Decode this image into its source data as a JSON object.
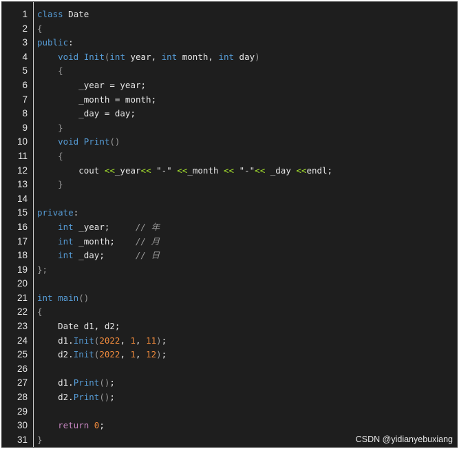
{
  "editor": {
    "lines": [
      {
        "n": "1",
        "tokens": [
          [
            "kw",
            "class"
          ],
          [
            "plain",
            " Date"
          ]
        ]
      },
      {
        "n": "2",
        "tokens": [
          [
            "punc",
            "{"
          ]
        ]
      },
      {
        "n": "3",
        "tokens": [
          [
            "kw",
            "public"
          ],
          [
            "plain",
            ":"
          ]
        ]
      },
      {
        "n": "4",
        "tokens": [
          [
            "plain",
            "    "
          ],
          [
            "ty",
            "void"
          ],
          [
            "plain",
            " "
          ],
          [
            "fn",
            "Init"
          ],
          [
            "punc",
            "("
          ],
          [
            "ty",
            "int"
          ],
          [
            "plain",
            " year, "
          ],
          [
            "ty",
            "int"
          ],
          [
            "plain",
            " month, "
          ],
          [
            "ty",
            "int"
          ],
          [
            "plain",
            " day"
          ],
          [
            "punc",
            ")"
          ]
        ]
      },
      {
        "n": "5",
        "tokens": [
          [
            "plain",
            "    "
          ],
          [
            "punc",
            "{"
          ]
        ]
      },
      {
        "n": "6",
        "tokens": [
          [
            "plain",
            "        _year = year;"
          ]
        ]
      },
      {
        "n": "7",
        "tokens": [
          [
            "plain",
            "        _month = month;"
          ]
        ]
      },
      {
        "n": "8",
        "tokens": [
          [
            "plain",
            "        _day = day;"
          ]
        ]
      },
      {
        "n": "9",
        "tokens": [
          [
            "plain",
            "    "
          ],
          [
            "punc",
            "}"
          ]
        ]
      },
      {
        "n": "10",
        "tokens": [
          [
            "plain",
            "    "
          ],
          [
            "ty",
            "void"
          ],
          [
            "plain",
            " "
          ],
          [
            "fn",
            "Print"
          ],
          [
            "punc",
            "()"
          ]
        ]
      },
      {
        "n": "11",
        "tokens": [
          [
            "plain",
            "    "
          ],
          [
            "punc",
            "{"
          ]
        ]
      },
      {
        "n": "12",
        "tokens": [
          [
            "plain",
            "        cout "
          ],
          [
            "op",
            "<<"
          ],
          [
            "plain",
            "_year"
          ],
          [
            "op",
            "<<"
          ],
          [
            "plain",
            " \"-\" "
          ],
          [
            "op",
            "<<"
          ],
          [
            "plain",
            "_month "
          ],
          [
            "op",
            "<<"
          ],
          [
            "plain",
            " \"-\""
          ],
          [
            "op",
            "<<"
          ],
          [
            "plain",
            " _day "
          ],
          [
            "op",
            "<<"
          ],
          [
            "plain",
            "endl;"
          ]
        ]
      },
      {
        "n": "13",
        "tokens": [
          [
            "plain",
            "    "
          ],
          [
            "punc",
            "}"
          ]
        ]
      },
      {
        "n": "14",
        "tokens": []
      },
      {
        "n": "15",
        "tokens": [
          [
            "kw",
            "private"
          ],
          [
            "plain",
            ":"
          ]
        ]
      },
      {
        "n": "16",
        "tokens": [
          [
            "plain",
            "    "
          ],
          [
            "ty",
            "int"
          ],
          [
            "plain",
            " _year;     "
          ],
          [
            "cm",
            "// 年"
          ]
        ]
      },
      {
        "n": "17",
        "tokens": [
          [
            "plain",
            "    "
          ],
          [
            "ty",
            "int"
          ],
          [
            "plain",
            " _month;    "
          ],
          [
            "cm",
            "// 月"
          ]
        ]
      },
      {
        "n": "18",
        "tokens": [
          [
            "plain",
            "    "
          ],
          [
            "ty",
            "int"
          ],
          [
            "plain",
            " _day;      "
          ],
          [
            "cm",
            "// 日"
          ]
        ]
      },
      {
        "n": "19",
        "tokens": [
          [
            "punc",
            "};"
          ]
        ]
      },
      {
        "n": "20",
        "tokens": []
      },
      {
        "n": "21",
        "tokens": [
          [
            "ty",
            "int"
          ],
          [
            "plain",
            " "
          ],
          [
            "fn",
            "main"
          ],
          [
            "punc",
            "()"
          ]
        ]
      },
      {
        "n": "22",
        "tokens": [
          [
            "punc",
            "{"
          ]
        ]
      },
      {
        "n": "23",
        "tokens": [
          [
            "plain",
            "    Date d1, d2;"
          ]
        ]
      },
      {
        "n": "24",
        "tokens": [
          [
            "plain",
            "    d1."
          ],
          [
            "fn",
            "Init"
          ],
          [
            "punc",
            "("
          ],
          [
            "num",
            "2022"
          ],
          [
            "plain",
            ", "
          ],
          [
            "num",
            "1"
          ],
          [
            "plain",
            ", "
          ],
          [
            "num",
            "11"
          ],
          [
            "punc",
            ")"
          ],
          [
            "plain",
            ";"
          ]
        ]
      },
      {
        "n": "25",
        "tokens": [
          [
            "plain",
            "    d2."
          ],
          [
            "fn",
            "Init"
          ],
          [
            "punc",
            "("
          ],
          [
            "num",
            "2022"
          ],
          [
            "plain",
            ", "
          ],
          [
            "num",
            "1"
          ],
          [
            "plain",
            ", "
          ],
          [
            "num",
            "12"
          ],
          [
            "punc",
            ")"
          ],
          [
            "plain",
            ";"
          ]
        ]
      },
      {
        "n": "26",
        "tokens": []
      },
      {
        "n": "27",
        "tokens": [
          [
            "plain",
            "    d1."
          ],
          [
            "fn",
            "Print"
          ],
          [
            "punc",
            "()"
          ],
          [
            "plain",
            ";"
          ]
        ]
      },
      {
        "n": "28",
        "tokens": [
          [
            "plain",
            "    d2."
          ],
          [
            "fn",
            "Print"
          ],
          [
            "punc",
            "()"
          ],
          [
            "plain",
            ";"
          ]
        ]
      },
      {
        "n": "29",
        "tokens": []
      },
      {
        "n": "30",
        "tokens": [
          [
            "plain",
            "    "
          ],
          [
            "kw2",
            "return"
          ],
          [
            "plain",
            " "
          ],
          [
            "num",
            "0"
          ],
          [
            "plain",
            ";"
          ]
        ]
      },
      {
        "n": "31",
        "tokens": [
          [
            "punc",
            "}"
          ]
        ]
      }
    ]
  },
  "watermark": "CSDN @yidianyebuxiang",
  "colors": {
    "background": "#1e1e1e",
    "keyword": "#569cd6",
    "number": "#f28b3c",
    "comment": "#9a9a9a"
  }
}
